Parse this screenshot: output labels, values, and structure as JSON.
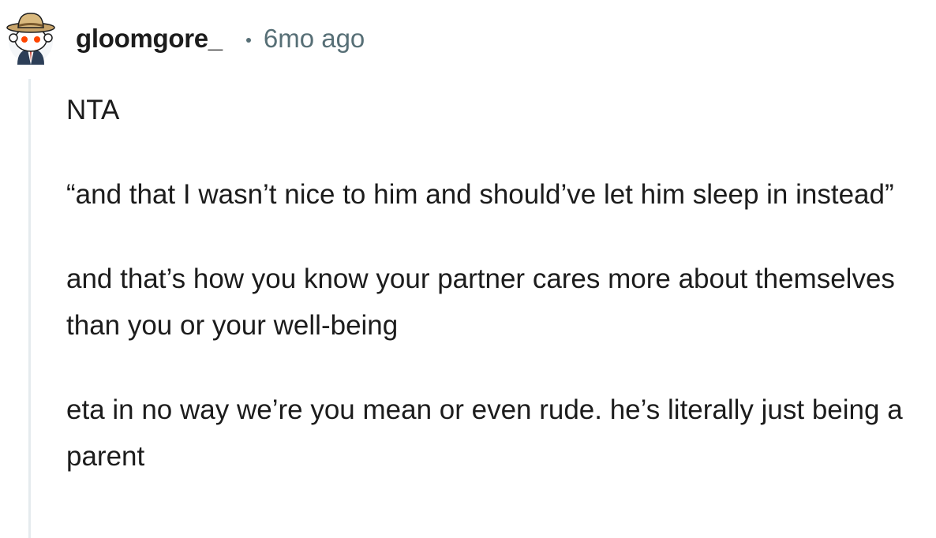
{
  "comment": {
    "author": "gloomgore_",
    "separator": "•",
    "timestamp": "6mo ago",
    "paragraphs": [
      "NTA",
      "“and that I wasn’t nice to him and should’ve let him sleep in instead”",
      "and that’s how you know your partner cares more about themselves than you or your well-being",
      "eta in no way we’re you mean or even rude. he’s literally just being a parent"
    ]
  },
  "colors": {
    "text": "#1c1c1c",
    "meta": "#576f76",
    "thread_line": "#e5ebee",
    "avatar_accent": "#ff4500"
  },
  "icons": {
    "avatar": "snoo-avatar-with-cowboy-hat"
  }
}
